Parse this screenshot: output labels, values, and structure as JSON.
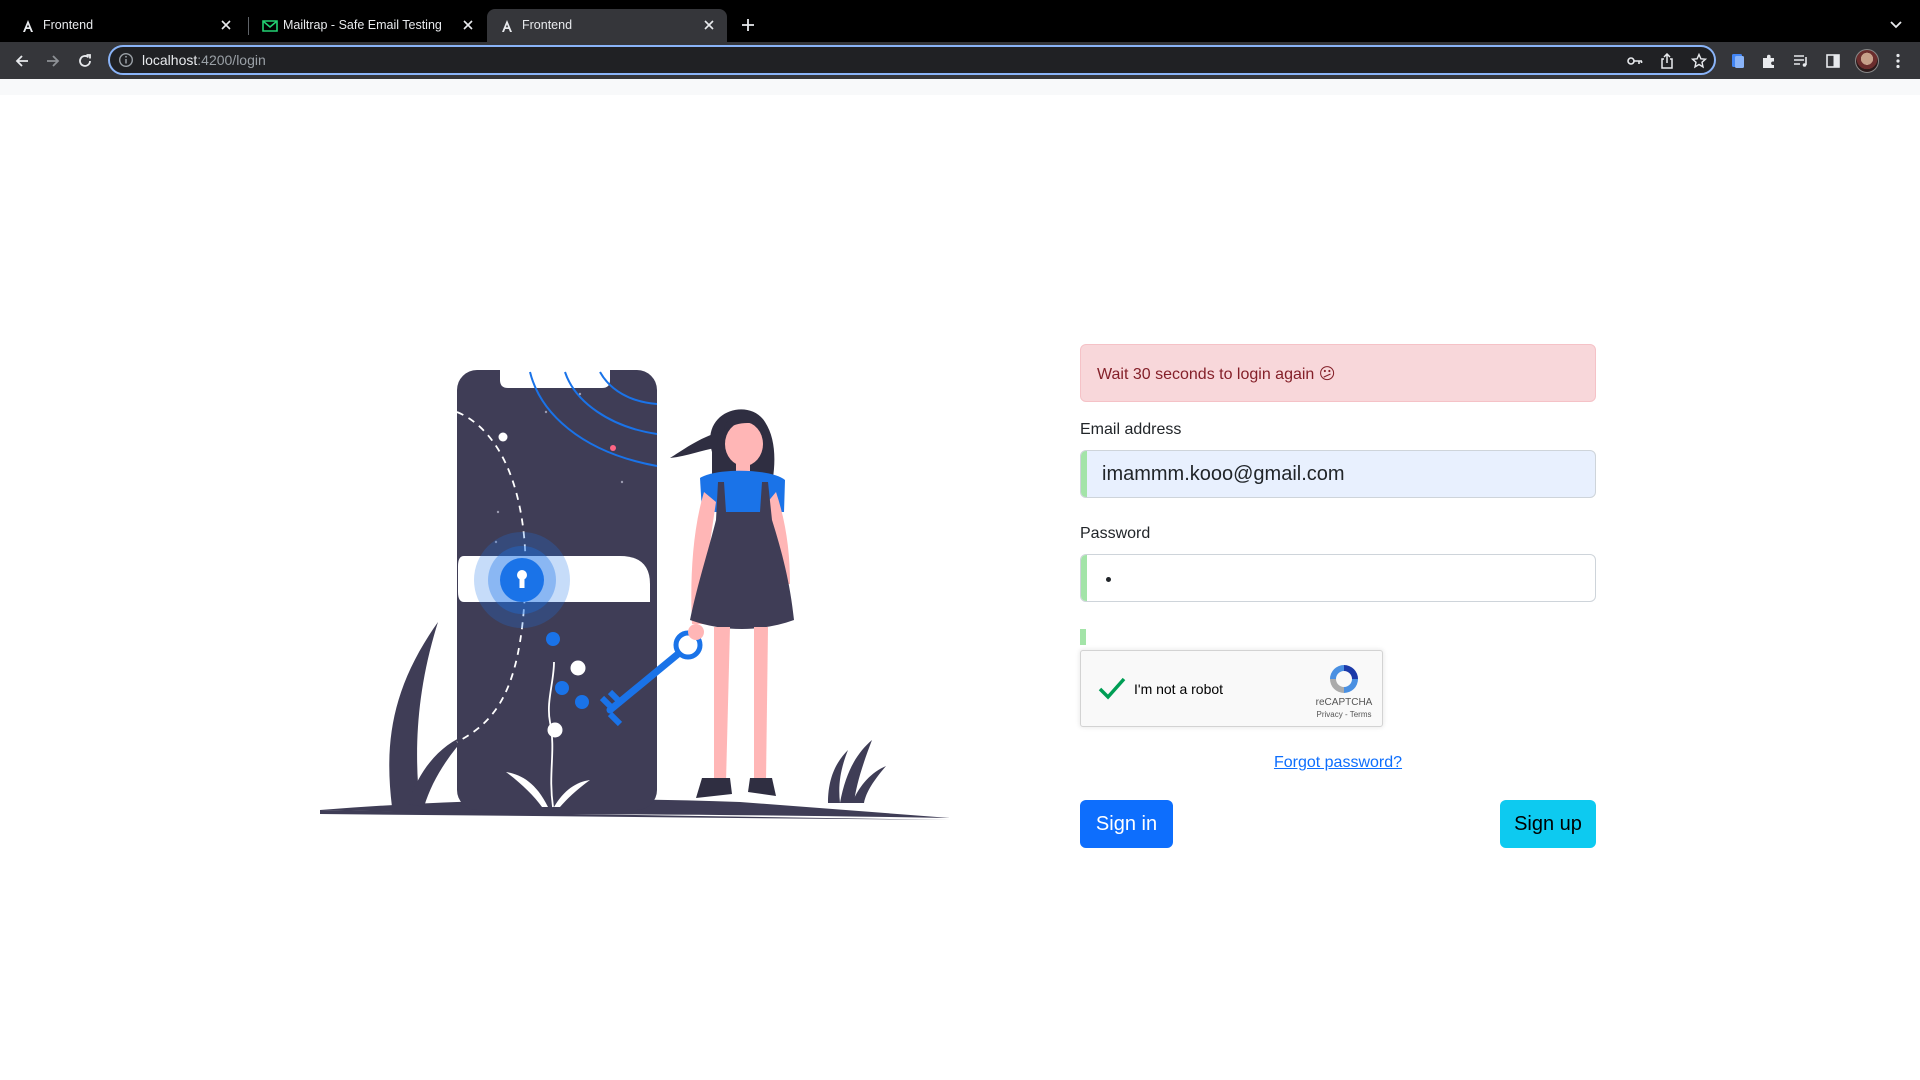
{
  "browser": {
    "tabs": [
      {
        "title": "Frontend",
        "favicon": "angular-icon",
        "active": false
      },
      {
        "title": "Mailtrap - Safe Email Testing",
        "favicon": "mailtrap-icon",
        "active": false
      },
      {
        "title": "Frontend",
        "favicon": "angular-icon",
        "active": true
      }
    ],
    "address": {
      "host": "localhost",
      "path": ":4200/login"
    },
    "accent_color": "#8ab4f8"
  },
  "login": {
    "alert": "Wait 30 seconds to login again 😕",
    "email_label": "Email address",
    "email_value": "imammm.kooo@gmail.com",
    "password_label": "Password",
    "captcha": {
      "label": "I'm not a robot",
      "brand": "reCAPTCHA",
      "links": "Privacy - Terms",
      "checked": true
    },
    "forgot_link": "Forgot password?",
    "signin_label": "Sign in",
    "signup_label": "Sign up"
  },
  "colors": {
    "alert_bg": "#f8d7da",
    "alert_text": "#842029",
    "primary": "#0d6efd",
    "info": "#0dcaf0",
    "valid_bar": "#a3e4a8",
    "illustration_dark": "#3f3d56",
    "illustration_blue": "#1a73e8",
    "skin": "#ffb6b6"
  }
}
